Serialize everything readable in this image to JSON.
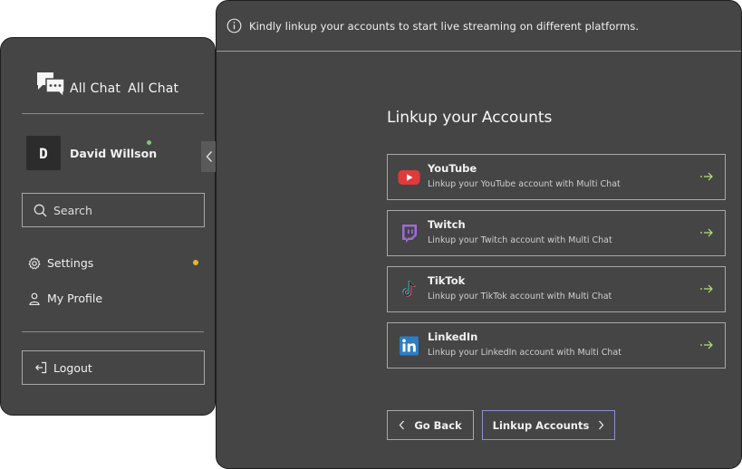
{
  "sidebar": {
    "brand": {
      "name": "All Chat",
      "name_repeat": "All Chat",
      "icon": "chat-bubbles-icon"
    },
    "user": {
      "initial": "D",
      "name": "David Willson",
      "status": "online",
      "status_color": "#7ec77a"
    },
    "search": {
      "label": "Search",
      "icon": "search-icon"
    },
    "nav": [
      {
        "label": "Settings",
        "icon": "gear-icon",
        "badge_color": "#e8b530"
      },
      {
        "label": "My Profile",
        "icon": "user-icon"
      }
    ],
    "logout": {
      "label": "Logout",
      "icon": "logout-icon"
    }
  },
  "main": {
    "banner": {
      "icon": "info-icon",
      "text": "Kindly linkup your accounts to start live streaming on different platforms."
    },
    "heading": "Linkup your Accounts",
    "accounts": [
      {
        "name": "YouTube",
        "description": "Linkup your YouTube account with Multi Chat",
        "icon": "youtube-icon",
        "color": "#e03a3a"
      },
      {
        "name": "Twitch",
        "description": "Linkup your Twitch account with Multi Chat",
        "icon": "twitch-icon",
        "color": "#9b6cd6"
      },
      {
        "name": "TikTok",
        "description": "Linkup your TikTok account with Multi Chat",
        "icon": "tiktok-icon",
        "color": "#f05c7e"
      },
      {
        "name": "LinkedIn",
        "description": "Linkup your LinkedIn account with Multi Chat",
        "icon": "linkedin-icon",
        "color": "#2b7ec2"
      }
    ],
    "arrow_color": "#b5e07a",
    "buttons": {
      "back": "Go Back",
      "linkup": "Linkup Accounts"
    }
  }
}
